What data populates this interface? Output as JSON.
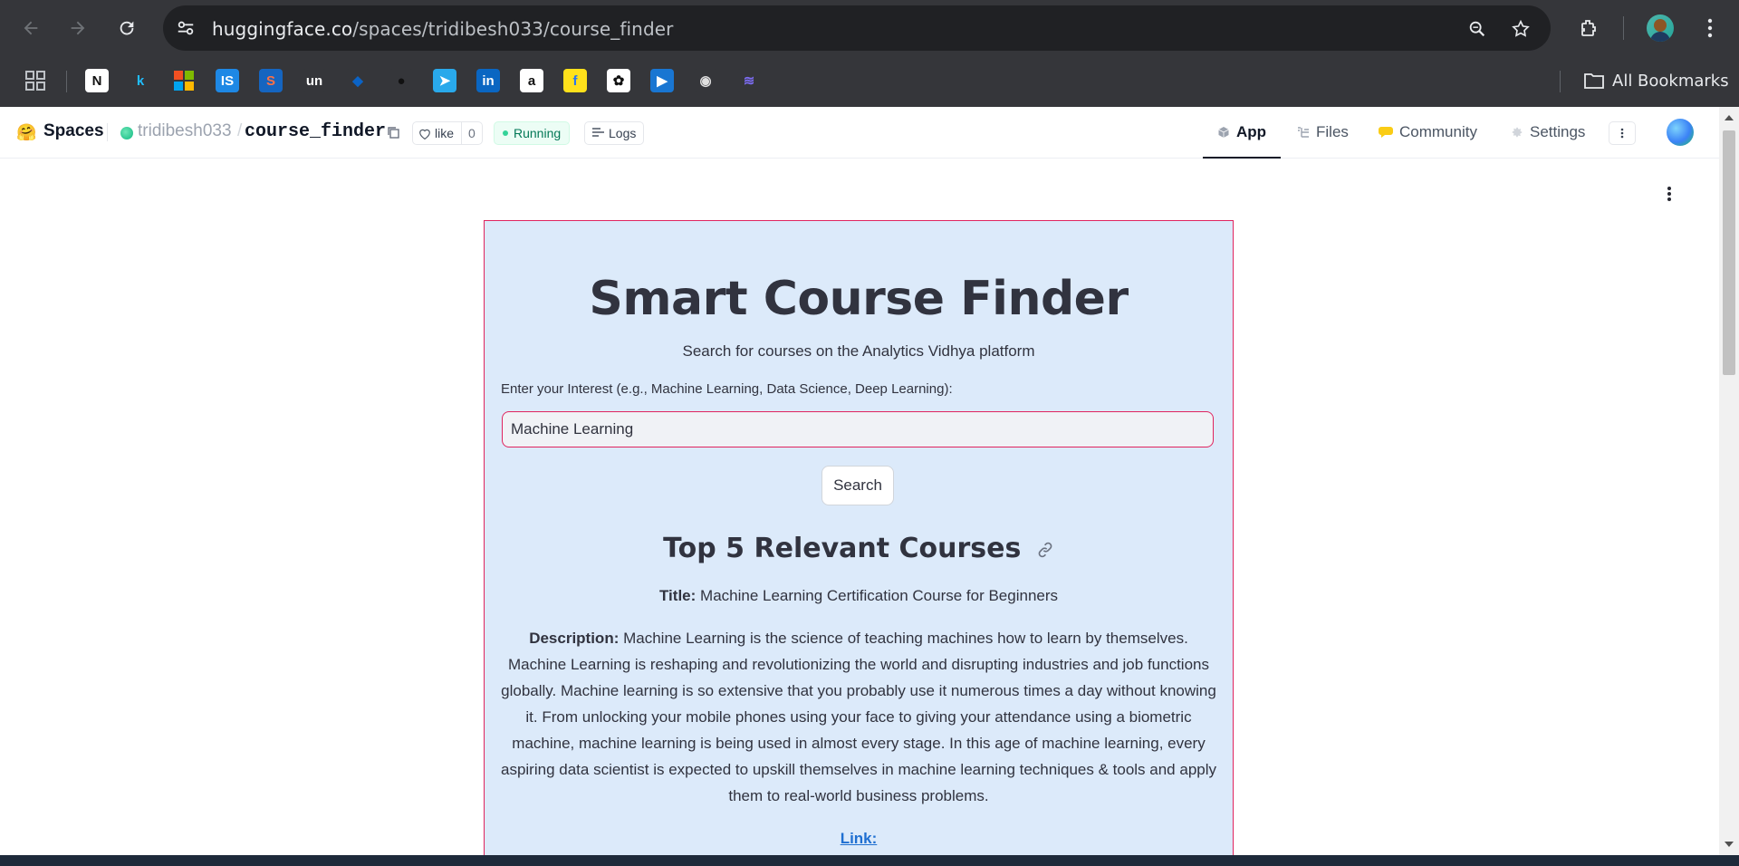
{
  "browser": {
    "url_host": "huggingface.co",
    "url_path": "/spaces/tridibesh033/course_finder",
    "all_bookmarks_label": "All Bookmarks",
    "bookmarks": [
      {
        "name": "notion",
        "glyph": "N",
        "color": "#ffffff",
        "fg": "#111111"
      },
      {
        "name": "kaggle",
        "glyph": "k",
        "color": "#35363a",
        "fg": "#20beff"
      },
      {
        "name": "microsoft",
        "glyph": "",
        "color": "#35363a",
        "fg": "#ffffff"
      },
      {
        "name": "is",
        "glyph": "IS",
        "color": "#1e88e5",
        "fg": "#ffffff"
      },
      {
        "name": "s-app",
        "glyph": "S",
        "color": "#1565c0",
        "fg": "#ff7043"
      },
      {
        "name": "unstop",
        "glyph": "un",
        "color": "#35363a",
        "fg": "#ffffff"
      },
      {
        "name": "vscode",
        "glyph": "◆",
        "color": "#35363a",
        "fg": "#0b63c5"
      },
      {
        "name": "github",
        "glyph": "●",
        "color": "#35363a",
        "fg": "#111111"
      },
      {
        "name": "telegram",
        "glyph": "➤",
        "color": "#29a9eb",
        "fg": "#ffffff"
      },
      {
        "name": "linkedin",
        "glyph": "in",
        "color": "#0a66c2",
        "fg": "#ffffff"
      },
      {
        "name": "amazon",
        "glyph": "a",
        "color": "#ffffff",
        "fg": "#111111"
      },
      {
        "name": "flipkart",
        "glyph": "f",
        "color": "#ffe11b",
        "fg": "#2874f0"
      },
      {
        "name": "chatgpt",
        "glyph": "✿",
        "color": "#ffffff",
        "fg": "#111111"
      },
      {
        "name": "video",
        "glyph": "▶",
        "color": "#1976d2",
        "fg": "#ffffff"
      },
      {
        "name": "pill",
        "glyph": "◉",
        "color": "#35363a",
        "fg": "#e0e0e0"
      },
      {
        "name": "layers",
        "glyph": "≋",
        "color": "#35363a",
        "fg": "#7c6cf2"
      }
    ]
  },
  "hf_header": {
    "spaces_label": "Spaces",
    "owner": "tridibesh033",
    "separator": "/",
    "repo": "course_finder",
    "like_label": "like",
    "like_count": "0",
    "status": "Running",
    "logs_label": "Logs",
    "tabs": [
      {
        "label": "App",
        "icon": "cube-icon"
      },
      {
        "label": "Files",
        "icon": "files-icon"
      },
      {
        "label": "Community",
        "icon": "chat-bubble-icon"
      },
      {
        "label": "Settings",
        "icon": "gear-icon"
      }
    ]
  },
  "app": {
    "title": "Smart Course Finder",
    "subtitle": "Search for courses on the Analytics Vidhya platform",
    "input_label": "Enter your Interest (e.g., Machine Learning, Data Science, Deep Learning):",
    "input_value": "Machine Learning",
    "search_button": "Search",
    "results_heading": "Top 5 Relevant Courses",
    "course": {
      "title_label": "Title:",
      "title": "Machine Learning Certification Course for Beginners",
      "description_label": "Description:",
      "description": "Machine Learning is the science of teaching machines how to learn by themselves. Machine Learning is reshaping and revolutionizing the world and disrupting industries and job functions globally. Machine learning is so extensive that you probably use it numerous times a day without knowing it. From unlocking your mobile phones using your face to giving your attendance using a biometric machine, machine learning is being used in almost every stage. In this age of machine learning, every aspiring data scientist is expected to upskill themselves in machine learning techniques & tools and apply them to real-world business problems.",
      "link_label": "Link:"
    }
  },
  "colors": {
    "card_bg": "#dceafa",
    "card_border": "#e0245e",
    "link": "#1f6fd1",
    "running_green": "#047857"
  }
}
